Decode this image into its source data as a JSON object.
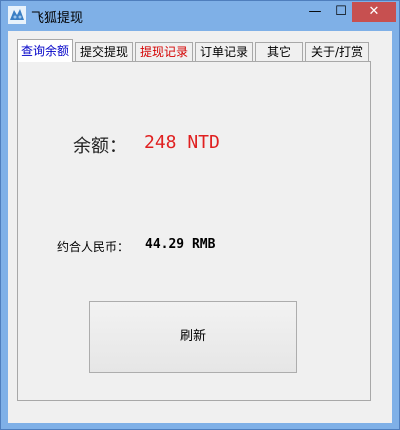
{
  "window": {
    "title": "飞狐提现",
    "minimize_glyph": "—",
    "maximize_glyph": "☐",
    "close_glyph": "✕"
  },
  "tabs": [
    {
      "label": "查询余额",
      "active": true,
      "color": "#0000c8"
    },
    {
      "label": "提交提现",
      "active": false,
      "color": "#000000"
    },
    {
      "label": "提现记录",
      "active": false,
      "color": "#d40000"
    },
    {
      "label": "订单记录",
      "active": false,
      "color": "#000000"
    },
    {
      "label": "其它",
      "active": false,
      "color": "#000000"
    },
    {
      "label": "关于/打赏",
      "active": false,
      "color": "#000000"
    }
  ],
  "balance": {
    "label": "余额：",
    "value": "248 NTD",
    "value_color": "#e02020"
  },
  "rmb": {
    "label": "约合人民币：",
    "value": "44.29 RMB"
  },
  "buttons": {
    "refresh_label": "刷新"
  },
  "colors": {
    "titlebar": "#7fb0e7",
    "close_button": "#c75050"
  }
}
